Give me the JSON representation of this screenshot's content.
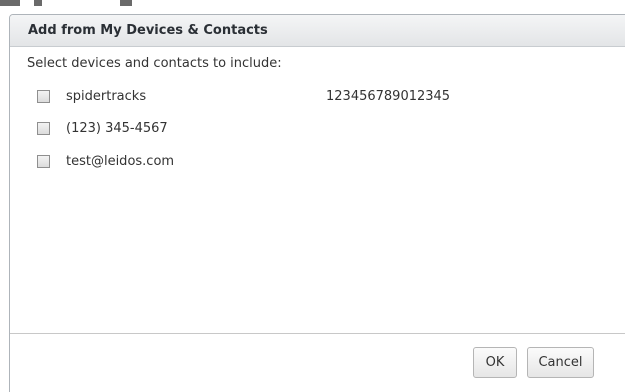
{
  "dialog": {
    "title": "Add from My Devices & Contacts",
    "prompt": "Select devices and contacts to include:"
  },
  "items": [
    {
      "label": "spidertracks",
      "detail": "123456789012345",
      "checked": false
    },
    {
      "label": "(123) 345-4567",
      "detail": "",
      "checked": false
    },
    {
      "label": "test@leidos.com",
      "detail": "",
      "checked": false
    }
  ],
  "buttons": {
    "ok_label": "OK",
    "cancel_label": "Cancel"
  }
}
